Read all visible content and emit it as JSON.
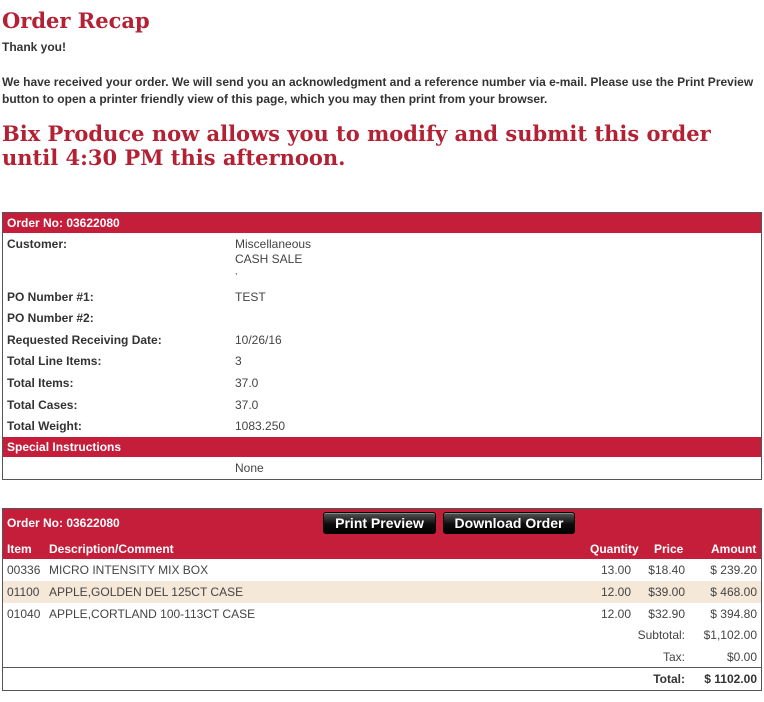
{
  "header": {
    "title": "Order Recap",
    "thanks": "Thank you!",
    "intro": "We have received your order.  We will send you an acknowledgment and a reference number via e-mail.  Please use the Print Preview button to open a printer friendly view of this page, which you may then print from your browser.",
    "headline": "Bix Produce now allows you to modify and submit this order until 4:30 PM this afternoon."
  },
  "order_details": {
    "order_no_label": "Order No: 03622080",
    "customer_label": "Customer:",
    "customer_line1": "Miscellaneous",
    "customer_line2": "CASH SALE",
    "customer_line3": ",",
    "po1_label": "PO Number #1:",
    "po1_value": "TEST",
    "po2_label": "PO Number #2:",
    "po2_value": "",
    "receiving_label": "Requested Receiving Date:",
    "receiving_value": "10/26/16",
    "line_items_label": "Total Line Items:",
    "line_items_value": "3",
    "items_label": "Total Items:",
    "items_value": "37.0",
    "cases_label": "Total Cases:",
    "cases_value": "37.0",
    "weight_label": "Total Weight:",
    "weight_value": "1083.250",
    "special_label": "Special Instructions",
    "special_value": "None"
  },
  "order_lines": {
    "order_no_label": "Order No: 03622080",
    "print_preview_label": "Print Preview",
    "download_label": "Download Order",
    "columns": {
      "item": "Item",
      "description": "Description/Comment",
      "quantity": "Quantity",
      "price": "Price",
      "amount": "Amount"
    },
    "rows": [
      {
        "item": "00336",
        "description": "MICRO INTENSITY MIX BOX",
        "quantity": "13.00",
        "price": "$18.40",
        "amount": "$ 239.20"
      },
      {
        "item": "01100",
        "description": "APPLE,GOLDEN DEL 125CT CASE",
        "quantity": "12.00",
        "price": "$39.00",
        "amount": "$ 468.00"
      },
      {
        "item": "01040",
        "description": "APPLE,CORTLAND 100-113CT CASE",
        "quantity": "12.00",
        "price": "$32.90",
        "amount": "$ 394.80"
      }
    ],
    "subtotal_label": "Subtotal:",
    "subtotal_value": "$1,102.00",
    "tax_label": "Tax:",
    "tax_value": "$0.00",
    "total_label": "Total:",
    "total_value": "$ 1102.00"
  },
  "colors": {
    "brand_red": "#c41e3a",
    "title_red": "#b22234",
    "alt_row": "#f5e8d8"
  }
}
